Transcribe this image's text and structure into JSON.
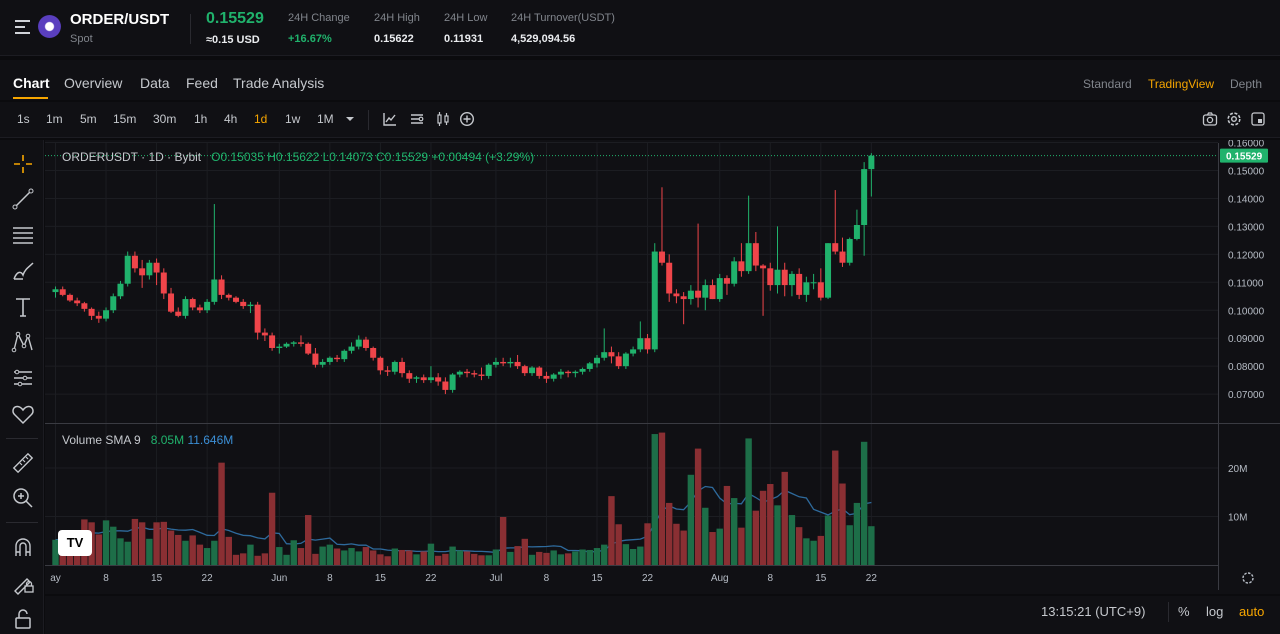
{
  "header": {
    "pair": "ORDER/USDT",
    "market": "Spot",
    "price": "0.15529",
    "price_usd": "≈0.15 USD",
    "stats": [
      {
        "label": "24H Change",
        "value": "+16.67%",
        "up": true
      },
      {
        "label": "24H High",
        "value": "0.15622",
        "up": false
      },
      {
        "label": "24H Low",
        "value": "0.11931",
        "up": false
      },
      {
        "label": "24H Turnover(USDT)",
        "value": "4,529,094.56",
        "up": false
      }
    ]
  },
  "tabs": [
    "Chart",
    "Overview",
    "Data",
    "Feed",
    "Trade Analysis"
  ],
  "views": [
    "Standard",
    "TradingView",
    "Depth"
  ],
  "timeframes": [
    "1s",
    "1m",
    "5m",
    "15m",
    "30m",
    "1h",
    "4h",
    "1d",
    "1w",
    "1M"
  ],
  "legend": {
    "symbol": "ORDERUSDT · 1D · Bybit",
    "open": "O0.15035",
    "high": "H0.15622",
    "low": "L0.14073",
    "close": "C0.15529",
    "change": "+0.00494 (+3.29%)",
    "volume_label": "Volume SMA 9",
    "volume_value": "8.05M",
    "sma_value": "11.646M"
  },
  "footer": {
    "clock": "13:15:21 (UTC+9)",
    "pct": "%",
    "log": "log",
    "auto": "auto"
  },
  "colors": {
    "up": "#20b26c",
    "down": "#ef454a",
    "accent": "#f7a600",
    "sma": "#2e6a9c"
  },
  "chart_data": {
    "type": "candlestick",
    "y_ticks": [
      "0.16000",
      "0.15000",
      "0.14000",
      "0.13000",
      "0.12000",
      "0.11000",
      "0.10000",
      "0.09000",
      "0.08000",
      "0.07000"
    ],
    "ylim": [
      0.065,
      0.16
    ],
    "current_price_label": "0.15529",
    "x_labels": [
      {
        "label": "ay",
        "idx": 0
      },
      {
        "label": "8",
        "idx": 7
      },
      {
        "label": "15",
        "idx": 14
      },
      {
        "label": "22",
        "idx": 21
      },
      {
        "label": "Jun",
        "idx": 31
      },
      {
        "label": "8",
        "idx": 38
      },
      {
        "label": "15",
        "idx": 45
      },
      {
        "label": "22",
        "idx": 52
      },
      {
        "label": "Jul",
        "idx": 61
      },
      {
        "label": "8",
        "idx": 68
      },
      {
        "label": "15",
        "idx": 75
      },
      {
        "label": "22",
        "idx": 82
      },
      {
        "label": "Aug",
        "idx": 92
      },
      {
        "label": "8",
        "idx": 99
      },
      {
        "label": "15",
        "idx": 106
      },
      {
        "label": "22",
        "idx": 113
      }
    ],
    "volume_ticks": [
      "20M",
      "10M"
    ],
    "volume_ylim": [
      0,
      28
    ],
    "ohlc": [
      [
        0.1065,
        0.1085,
        0.1045,
        0.1075
      ],
      [
        0.1075,
        0.1085,
        0.105,
        0.1055
      ],
      [
        0.1055,
        0.106,
        0.103,
        0.1035
      ],
      [
        0.1035,
        0.1045,
        0.1015,
        0.1025
      ],
      [
        0.1025,
        0.103,
        0.0995,
        0.1005
      ],
      [
        0.1005,
        0.101,
        0.0965,
        0.098
      ],
      [
        0.098,
        0.0995,
        0.0955,
        0.097
      ],
      [
        0.097,
        0.101,
        0.096,
        0.1
      ],
      [
        0.1,
        0.106,
        0.099,
        0.105
      ],
      [
        0.105,
        0.1105,
        0.104,
        0.1095
      ],
      [
        0.1095,
        0.121,
        0.1085,
        0.1195
      ],
      [
        0.1195,
        0.121,
        0.1135,
        0.115
      ],
      [
        0.115,
        0.118,
        0.108,
        0.1125
      ],
      [
        0.1125,
        0.118,
        0.111,
        0.117
      ],
      [
        0.117,
        0.1185,
        0.109,
        0.1135
      ],
      [
        0.1135,
        0.115,
        0.104,
        0.106
      ],
      [
        0.106,
        0.108,
        0.099,
        0.0995
      ],
      [
        0.0995,
        0.101,
        0.0975,
        0.098
      ],
      [
        0.098,
        0.105,
        0.097,
        0.104
      ],
      [
        0.104,
        0.1045,
        0.1,
        0.101
      ],
      [
        0.101,
        0.102,
        0.099,
        0.1
      ],
      [
        0.1,
        0.104,
        0.099,
        0.103
      ],
      [
        0.103,
        0.138,
        0.102,
        0.111
      ],
      [
        0.111,
        0.1125,
        0.104,
        0.1055
      ],
      [
        0.1055,
        0.106,
        0.1035,
        0.1045
      ],
      [
        0.1045,
        0.105,
        0.1025,
        0.103
      ],
      [
        0.103,
        0.104,
        0.1005,
        0.1015
      ],
      [
        0.1015,
        0.103,
        0.099,
        0.102
      ],
      [
        0.102,
        0.103,
        0.0895,
        0.092
      ],
      [
        0.092,
        0.0935,
        0.089,
        0.091
      ],
      [
        0.091,
        0.092,
        0.0855,
        0.0865
      ],
      [
        0.0865,
        0.088,
        0.0845,
        0.087
      ],
      [
        0.087,
        0.0885,
        0.0865,
        0.088
      ],
      [
        0.088,
        0.089,
        0.087,
        0.0885
      ],
      [
        0.0885,
        0.091,
        0.087,
        0.088
      ],
      [
        0.088,
        0.0885,
        0.084,
        0.0845
      ],
      [
        0.0845,
        0.0865,
        0.0795,
        0.0805
      ],
      [
        0.0805,
        0.0825,
        0.0795,
        0.0815
      ],
      [
        0.0815,
        0.0835,
        0.0805,
        0.083
      ],
      [
        0.083,
        0.084,
        0.0815,
        0.0825
      ],
      [
        0.0825,
        0.086,
        0.0815,
        0.0855
      ],
      [
        0.0855,
        0.0885,
        0.0845,
        0.087
      ],
      [
        0.087,
        0.091,
        0.086,
        0.0895
      ],
      [
        0.0895,
        0.0905,
        0.0855,
        0.0865
      ],
      [
        0.0865,
        0.087,
        0.082,
        0.083
      ],
      [
        0.083,
        0.0835,
        0.077,
        0.0785
      ],
      [
        0.0785,
        0.08,
        0.0765,
        0.078
      ],
      [
        0.078,
        0.082,
        0.077,
        0.0815
      ],
      [
        0.0815,
        0.083,
        0.076,
        0.0775
      ],
      [
        0.0775,
        0.0785,
        0.074,
        0.0755
      ],
      [
        0.0755,
        0.0765,
        0.074,
        0.076
      ],
      [
        0.076,
        0.077,
        0.074,
        0.075
      ],
      [
        0.075,
        0.08,
        0.074,
        0.076
      ],
      [
        0.076,
        0.0775,
        0.073,
        0.0745
      ],
      [
        0.0745,
        0.076,
        0.07,
        0.0715
      ],
      [
        0.0715,
        0.0775,
        0.0705,
        0.077
      ],
      [
        0.077,
        0.0785,
        0.076,
        0.078
      ],
      [
        0.078,
        0.079,
        0.076,
        0.0775
      ],
      [
        0.0775,
        0.0785,
        0.076,
        0.077
      ],
      [
        0.077,
        0.0795,
        0.075,
        0.0765
      ],
      [
        0.0765,
        0.081,
        0.0755,
        0.0805
      ],
      [
        0.0805,
        0.083,
        0.0795,
        0.0815
      ],
      [
        0.0815,
        0.083,
        0.08,
        0.081
      ],
      [
        0.081,
        0.083,
        0.0795,
        0.0815
      ],
      [
        0.0815,
        0.084,
        0.079,
        0.08
      ],
      [
        0.08,
        0.0805,
        0.0765,
        0.0775
      ],
      [
        0.0775,
        0.08,
        0.0765,
        0.0795
      ],
      [
        0.0795,
        0.08,
        0.0755,
        0.0765
      ],
      [
        0.0765,
        0.078,
        0.074,
        0.0755
      ],
      [
        0.0755,
        0.0775,
        0.0745,
        0.077
      ],
      [
        0.077,
        0.079,
        0.0755,
        0.078
      ],
      [
        0.078,
        0.0785,
        0.076,
        0.0775
      ],
      [
        0.0775,
        0.0785,
        0.076,
        0.078
      ],
      [
        0.078,
        0.0795,
        0.077,
        0.079
      ],
      [
        0.079,
        0.0815,
        0.078,
        0.081
      ],
      [
        0.081,
        0.084,
        0.0795,
        0.083
      ],
      [
        0.083,
        0.0935,
        0.082,
        0.085
      ],
      [
        0.085,
        0.087,
        0.081,
        0.0835
      ],
      [
        0.0835,
        0.085,
        0.079,
        0.08
      ],
      [
        0.08,
        0.085,
        0.079,
        0.0845
      ],
      [
        0.0845,
        0.087,
        0.0835,
        0.086
      ],
      [
        0.086,
        0.096,
        0.085,
        0.09
      ],
      [
        0.09,
        0.0915,
        0.0845,
        0.086
      ],
      [
        0.086,
        0.124,
        0.085,
        0.121
      ],
      [
        0.121,
        0.144,
        0.116,
        0.117
      ],
      [
        0.117,
        0.12,
        0.103,
        0.106
      ],
      [
        0.106,
        0.1075,
        0.1025,
        0.105
      ],
      [
        0.105,
        0.1065,
        0.095,
        0.104
      ],
      [
        0.104,
        0.109,
        0.102,
        0.107
      ],
      [
        0.107,
        0.131,
        0.101,
        0.1045
      ],
      [
        0.1045,
        0.111,
        0.1,
        0.109
      ],
      [
        0.109,
        0.111,
        0.104,
        0.104
      ],
      [
        0.104,
        0.113,
        0.103,
        0.1115
      ],
      [
        0.1115,
        0.1125,
        0.1055,
        0.1095
      ],
      [
        0.1095,
        0.119,
        0.1085,
        0.1175
      ],
      [
        0.1175,
        0.124,
        0.112,
        0.114
      ],
      [
        0.114,
        0.141,
        0.113,
        0.124
      ],
      [
        0.124,
        0.128,
        0.114,
        0.116
      ],
      [
        0.116,
        0.1165,
        0.098,
        0.115
      ],
      [
        0.115,
        0.117,
        0.107,
        0.109
      ],
      [
        0.109,
        0.13,
        0.106,
        0.1145
      ],
      [
        0.1145,
        0.117,
        0.105,
        0.109
      ],
      [
        0.109,
        0.114,
        0.105,
        0.113
      ],
      [
        0.113,
        0.115,
        0.104,
        0.1055
      ],
      [
        0.1055,
        0.112,
        0.103,
        0.11
      ],
      [
        0.11,
        0.113,
        0.1075,
        0.11
      ],
      [
        0.11,
        0.115,
        0.1035,
        0.1045
      ],
      [
        0.1045,
        0.124,
        0.104,
        0.124
      ],
      [
        0.124,
        0.143,
        0.12,
        0.121
      ],
      [
        0.121,
        0.126,
        0.1155,
        0.117
      ],
      [
        0.117,
        0.126,
        0.116,
        0.1255
      ],
      [
        0.1255,
        0.136,
        0.125,
        0.1305
      ],
      [
        0.1305,
        0.153,
        0.1195,
        0.1505
      ],
      [
        0.1505,
        0.1562,
        0.1407,
        0.1553
      ]
    ],
    "volume": [
      5.2,
      5.5,
      4.8,
      6.1,
      9.4,
      8.8,
      6.3,
      9.2,
      7.9,
      5.5,
      4.8,
      9.5,
      8.8,
      5.4,
      8.8,
      8.9,
      7.1,
      6.2,
      5.0,
      6.1,
      4.2,
      3.5,
      5.0,
      21.1,
      5.8,
      2.1,
      2.4,
      4.2,
      1.9,
      2.4,
      14.9,
      3.7,
      2.1,
      5.1,
      3.5,
      10.3,
      2.3,
      3.8,
      4.2,
      3.4,
      3.0,
      3.5,
      2.8,
      3.7,
      3.0,
      2.2,
      1.8,
      3.4,
      3.1,
      3.0,
      2.2,
      2.8,
      4.4,
      1.9,
      2.3,
      3.8,
      3.0,
      2.8,
      2.3,
      2.0,
      2.0,
      3.2,
      9.9,
      2.7,
      3.9,
      5.4,
      2.1,
      2.7,
      2.5,
      3.0,
      2.2,
      2.4,
      2.8,
      3.2,
      3.1,
      3.5,
      4.2,
      14.2,
      8.4,
      4.3,
      3.3,
      3.8,
      8.6,
      27.0,
      27.3,
      12.8,
      8.5,
      7.1,
      18.6,
      24.0,
      11.8,
      6.8,
      7.5,
      16.3,
      13.8,
      7.7,
      26.1,
      11.2,
      15.3,
      16.7,
      12.3,
      19.2,
      10.3,
      7.8,
      5.5,
      5.0,
      6.0,
      10.2,
      23.6,
      16.8,
      8.2,
      12.8,
      25.4,
      8.0
    ]
  }
}
